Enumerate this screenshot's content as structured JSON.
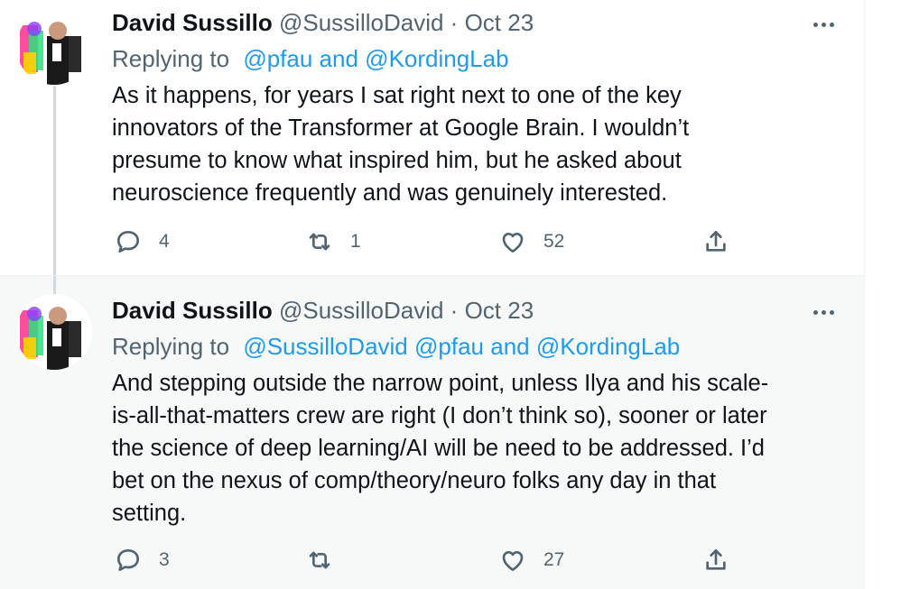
{
  "tweets": [
    {
      "author": {
        "name": "David Sussillo",
        "handle": "@SussilloDavid"
      },
      "separator": "·",
      "date": "Oct 23",
      "replying_prefix": "Replying to",
      "replying_mentions": [
        "@pfau",
        "and",
        "@KordingLab"
      ],
      "text_lines": [
        "As it happens, for years I sat right next to one of the key",
        "innovators of the Transformer at Google Brain. I wouldn’t",
        "presume to know what inspired him, but he asked about",
        "neuroscience frequently and was genuinely interested."
      ],
      "actions": {
        "reply_count": "4",
        "retweet_count": "1",
        "like_count": "52"
      }
    },
    {
      "author": {
        "name": "David Sussillo",
        "handle": "@SussilloDavid"
      },
      "separator": "·",
      "date": "Oct 23",
      "replying_prefix": "Replying to",
      "replying_mentions": [
        "@SussilloDavid",
        "@pfau",
        "and",
        "@KordingLab"
      ],
      "text_lines": [
        "And stepping outside the narrow point, unless Ilya and his scale-",
        "is-all-that-matters crew are right (I don’t think so), sooner or later",
        "the science of deep learning/AI will be need to be addressed. I’d",
        "bet on the nexus of comp/theory/neuro folks any day in that",
        "setting."
      ],
      "actions": {
        "reply_count": "3",
        "retweet_count": "",
        "like_count": "27"
      }
    }
  ],
  "colors": {
    "link": "#1d9bf0",
    "secondary_text": "#536471",
    "primary_text": "#0f1419",
    "selected_tweet_bg": "#f7f9f9",
    "thread_line": "#cfd9de"
  },
  "icons": [
    "reply-icon",
    "retweet-icon",
    "like-icon",
    "share-icon",
    "more-icon"
  ]
}
